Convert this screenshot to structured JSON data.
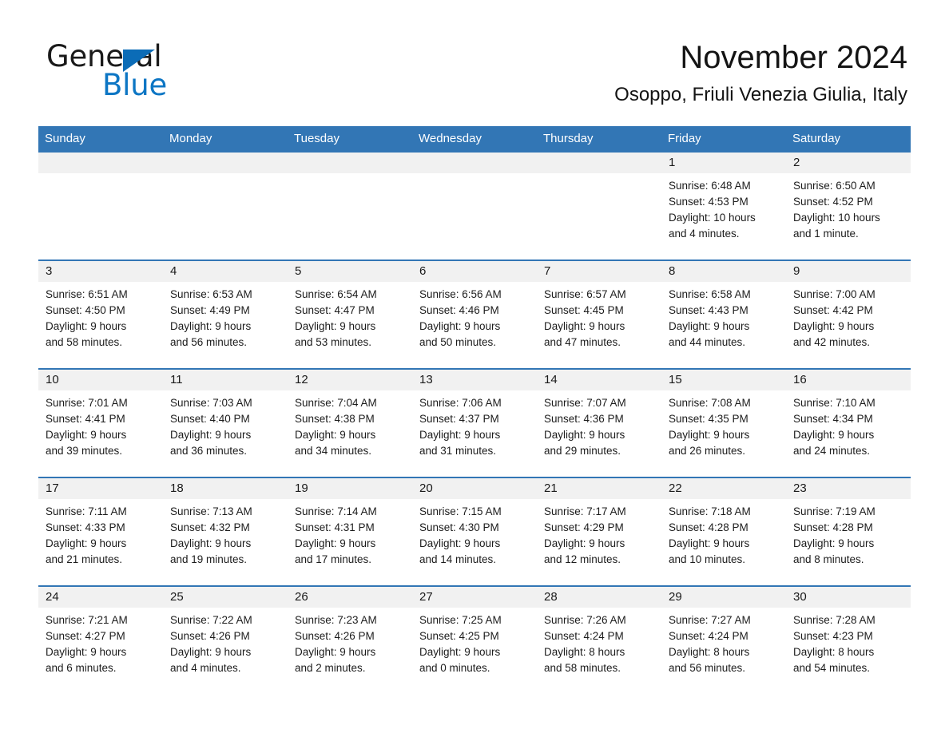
{
  "brand": {
    "line1": "General",
    "line2": "Blue",
    "triangle_color": "#0b6cb7",
    "blue_color": "#0d76c4"
  },
  "header": {
    "month_title": "November 2024",
    "location": "Osoppo, Friuli Venezia Giulia, Italy"
  },
  "theme": {
    "header_blue": "#3276b5",
    "daynum_band": "#f1f1f1",
    "row_separator": "#3276b5"
  },
  "weekdays": [
    "Sunday",
    "Monday",
    "Tuesday",
    "Wednesday",
    "Thursday",
    "Friday",
    "Saturday"
  ],
  "weeks": [
    [
      {
        "day": "",
        "sunrise": "",
        "sunset": "",
        "daylight1": "",
        "daylight2": ""
      },
      {
        "day": "",
        "sunrise": "",
        "sunset": "",
        "daylight1": "",
        "daylight2": ""
      },
      {
        "day": "",
        "sunrise": "",
        "sunset": "",
        "daylight1": "",
        "daylight2": ""
      },
      {
        "day": "",
        "sunrise": "",
        "sunset": "",
        "daylight1": "",
        "daylight2": ""
      },
      {
        "day": "",
        "sunrise": "",
        "sunset": "",
        "daylight1": "",
        "daylight2": ""
      },
      {
        "day": "1",
        "sunrise": "Sunrise: 6:48 AM",
        "sunset": "Sunset: 4:53 PM",
        "daylight1": "Daylight: 10 hours",
        "daylight2": "and 4 minutes."
      },
      {
        "day": "2",
        "sunrise": "Sunrise: 6:50 AM",
        "sunset": "Sunset: 4:52 PM",
        "daylight1": "Daylight: 10 hours",
        "daylight2": "and 1 minute."
      }
    ],
    [
      {
        "day": "3",
        "sunrise": "Sunrise: 6:51 AM",
        "sunset": "Sunset: 4:50 PM",
        "daylight1": "Daylight: 9 hours",
        "daylight2": "and 58 minutes."
      },
      {
        "day": "4",
        "sunrise": "Sunrise: 6:53 AM",
        "sunset": "Sunset: 4:49 PM",
        "daylight1": "Daylight: 9 hours",
        "daylight2": "and 56 minutes."
      },
      {
        "day": "5",
        "sunrise": "Sunrise: 6:54 AM",
        "sunset": "Sunset: 4:47 PM",
        "daylight1": "Daylight: 9 hours",
        "daylight2": "and 53 minutes."
      },
      {
        "day": "6",
        "sunrise": "Sunrise: 6:56 AM",
        "sunset": "Sunset: 4:46 PM",
        "daylight1": "Daylight: 9 hours",
        "daylight2": "and 50 minutes."
      },
      {
        "day": "7",
        "sunrise": "Sunrise: 6:57 AM",
        "sunset": "Sunset: 4:45 PM",
        "daylight1": "Daylight: 9 hours",
        "daylight2": "and 47 minutes."
      },
      {
        "day": "8",
        "sunrise": "Sunrise: 6:58 AM",
        "sunset": "Sunset: 4:43 PM",
        "daylight1": "Daylight: 9 hours",
        "daylight2": "and 44 minutes."
      },
      {
        "day": "9",
        "sunrise": "Sunrise: 7:00 AM",
        "sunset": "Sunset: 4:42 PM",
        "daylight1": "Daylight: 9 hours",
        "daylight2": "and 42 minutes."
      }
    ],
    [
      {
        "day": "10",
        "sunrise": "Sunrise: 7:01 AM",
        "sunset": "Sunset: 4:41 PM",
        "daylight1": "Daylight: 9 hours",
        "daylight2": "and 39 minutes."
      },
      {
        "day": "11",
        "sunrise": "Sunrise: 7:03 AM",
        "sunset": "Sunset: 4:40 PM",
        "daylight1": "Daylight: 9 hours",
        "daylight2": "and 36 minutes."
      },
      {
        "day": "12",
        "sunrise": "Sunrise: 7:04 AM",
        "sunset": "Sunset: 4:38 PM",
        "daylight1": "Daylight: 9 hours",
        "daylight2": "and 34 minutes."
      },
      {
        "day": "13",
        "sunrise": "Sunrise: 7:06 AM",
        "sunset": "Sunset: 4:37 PM",
        "daylight1": "Daylight: 9 hours",
        "daylight2": "and 31 minutes."
      },
      {
        "day": "14",
        "sunrise": "Sunrise: 7:07 AM",
        "sunset": "Sunset: 4:36 PM",
        "daylight1": "Daylight: 9 hours",
        "daylight2": "and 29 minutes."
      },
      {
        "day": "15",
        "sunrise": "Sunrise: 7:08 AM",
        "sunset": "Sunset: 4:35 PM",
        "daylight1": "Daylight: 9 hours",
        "daylight2": "and 26 minutes."
      },
      {
        "day": "16",
        "sunrise": "Sunrise: 7:10 AM",
        "sunset": "Sunset: 4:34 PM",
        "daylight1": "Daylight: 9 hours",
        "daylight2": "and 24 minutes."
      }
    ],
    [
      {
        "day": "17",
        "sunrise": "Sunrise: 7:11 AM",
        "sunset": "Sunset: 4:33 PM",
        "daylight1": "Daylight: 9 hours",
        "daylight2": "and 21 minutes."
      },
      {
        "day": "18",
        "sunrise": "Sunrise: 7:13 AM",
        "sunset": "Sunset: 4:32 PM",
        "daylight1": "Daylight: 9 hours",
        "daylight2": "and 19 minutes."
      },
      {
        "day": "19",
        "sunrise": "Sunrise: 7:14 AM",
        "sunset": "Sunset: 4:31 PM",
        "daylight1": "Daylight: 9 hours",
        "daylight2": "and 17 minutes."
      },
      {
        "day": "20",
        "sunrise": "Sunrise: 7:15 AM",
        "sunset": "Sunset: 4:30 PM",
        "daylight1": "Daylight: 9 hours",
        "daylight2": "and 14 minutes."
      },
      {
        "day": "21",
        "sunrise": "Sunrise: 7:17 AM",
        "sunset": "Sunset: 4:29 PM",
        "daylight1": "Daylight: 9 hours",
        "daylight2": "and 12 minutes."
      },
      {
        "day": "22",
        "sunrise": "Sunrise: 7:18 AM",
        "sunset": "Sunset: 4:28 PM",
        "daylight1": "Daylight: 9 hours",
        "daylight2": "and 10 minutes."
      },
      {
        "day": "23",
        "sunrise": "Sunrise: 7:19 AM",
        "sunset": "Sunset: 4:28 PM",
        "daylight1": "Daylight: 9 hours",
        "daylight2": "and 8 minutes."
      }
    ],
    [
      {
        "day": "24",
        "sunrise": "Sunrise: 7:21 AM",
        "sunset": "Sunset: 4:27 PM",
        "daylight1": "Daylight: 9 hours",
        "daylight2": "and 6 minutes."
      },
      {
        "day": "25",
        "sunrise": "Sunrise: 7:22 AM",
        "sunset": "Sunset: 4:26 PM",
        "daylight1": "Daylight: 9 hours",
        "daylight2": "and 4 minutes."
      },
      {
        "day": "26",
        "sunrise": "Sunrise: 7:23 AM",
        "sunset": "Sunset: 4:26 PM",
        "daylight1": "Daylight: 9 hours",
        "daylight2": "and 2 minutes."
      },
      {
        "day": "27",
        "sunrise": "Sunrise: 7:25 AM",
        "sunset": "Sunset: 4:25 PM",
        "daylight1": "Daylight: 9 hours",
        "daylight2": "and 0 minutes."
      },
      {
        "day": "28",
        "sunrise": "Sunrise: 7:26 AM",
        "sunset": "Sunset: 4:24 PM",
        "daylight1": "Daylight: 8 hours",
        "daylight2": "and 58 minutes."
      },
      {
        "day": "29",
        "sunrise": "Sunrise: 7:27 AM",
        "sunset": "Sunset: 4:24 PM",
        "daylight1": "Daylight: 8 hours",
        "daylight2": "and 56 minutes."
      },
      {
        "day": "30",
        "sunrise": "Sunrise: 7:28 AM",
        "sunset": "Sunset: 4:23 PM",
        "daylight1": "Daylight: 8 hours",
        "daylight2": "and 54 minutes."
      }
    ]
  ]
}
